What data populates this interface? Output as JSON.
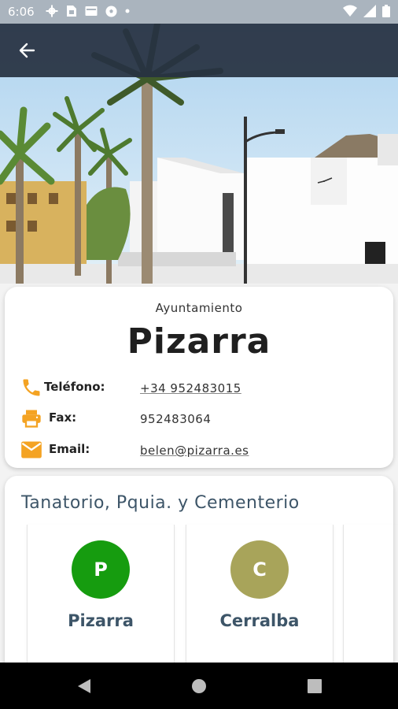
{
  "status_bar": {
    "time": "6:06"
  },
  "header": {
    "back_icon": "arrow-left-icon"
  },
  "contact": {
    "subtitle": "Ayuntamiento",
    "title": "Pizarra",
    "phone_label": "Teléfono:",
    "phone_value": "+34 952483015",
    "fax_label": "Fax:",
    "fax_value": "952483064",
    "email_label": "Email:",
    "email_value": "belen@pizarra.es"
  },
  "services": {
    "title": "Tanatorio, Pquia. y Cementerio",
    "items": [
      {
        "initial": "P",
        "name": "Pizarra",
        "color": "#169c0f"
      },
      {
        "initial": "C",
        "name": "Cerralba",
        "color": "#a8a45a"
      }
    ]
  },
  "colors": {
    "accent": "#f4a323",
    "app_bar": "#273242",
    "heading": "#3d5568"
  }
}
